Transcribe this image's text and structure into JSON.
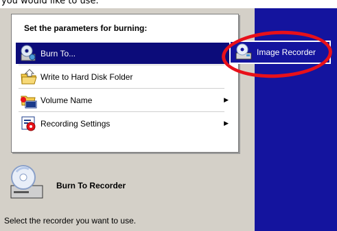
{
  "top_caption": "you would like to use.",
  "menu": {
    "header": "Set the parameters for burning:",
    "items": [
      {
        "label": "Burn To...",
        "icon": "burn-to-icon",
        "has_arrow": true
      },
      {
        "label": "Write to Hard Disk Folder",
        "icon": "folder-icon",
        "has_arrow": false
      },
      {
        "label": "Volume Name",
        "icon": "volume-name-icon",
        "has_arrow": true
      },
      {
        "label": "Recording Settings",
        "icon": "recording-settings-icon",
        "has_arrow": true
      }
    ],
    "arrow_glyph": "▶"
  },
  "submenu": {
    "label": "Image Recorder",
    "icon": "image-recorder-icon"
  },
  "section": {
    "title": "Burn To Recorder",
    "description": "Select the recorder you want to use.",
    "icon": "disc-recorder-icon"
  },
  "colors": {
    "selected_bg": "#0c0c7a",
    "right_panel": "#14149e",
    "left_panel": "#d4d0c8",
    "highlight": "#e8101a"
  }
}
